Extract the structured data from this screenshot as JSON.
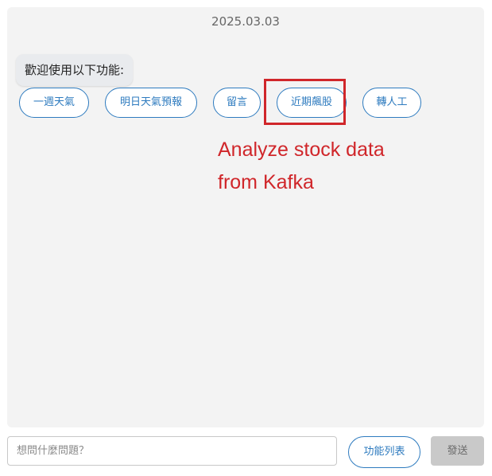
{
  "chat": {
    "date": "2025.03.03",
    "welcome_message": "歡迎使用以下功能:",
    "quick_replies": [
      {
        "label": "一週天氣"
      },
      {
        "label": "明日天氣預報"
      },
      {
        "label": "留言"
      },
      {
        "label": "近期飆股"
      },
      {
        "label": "轉人工"
      }
    ]
  },
  "annotation": {
    "line1": "Analyze stock data",
    "line2": "from Kafka",
    "color": "#d0262a"
  },
  "input_bar": {
    "placeholder": "想問什麼問題？",
    "function_list_label": "功能列表",
    "send_label": "發送"
  },
  "colors": {
    "accent": "#2e7bbf",
    "chat_background": "#f3f3f3",
    "send_disabled": "#c9c9c9"
  }
}
